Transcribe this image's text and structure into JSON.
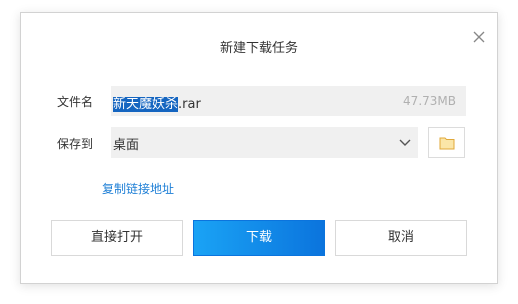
{
  "dialog": {
    "title": "新建下载任务",
    "close_icon": "close-icon"
  },
  "file": {
    "label": "文件名",
    "name_selected": "新天魔妖杀",
    "name_rest": ".rar",
    "size": "47.73MB"
  },
  "save": {
    "label": "保存到",
    "path": "桌面",
    "dropdown_icon": "chevron-down-icon",
    "browse_icon": "folder-icon"
  },
  "copy_link": "复制链接地址",
  "buttons": {
    "direct_open": "直接打开",
    "download": "下载",
    "cancel": "取消"
  },
  "colors": {
    "primary": "#0b74dd",
    "link": "#1e7fd6",
    "selection": "#1565c0",
    "folder": "#f2c45a"
  }
}
